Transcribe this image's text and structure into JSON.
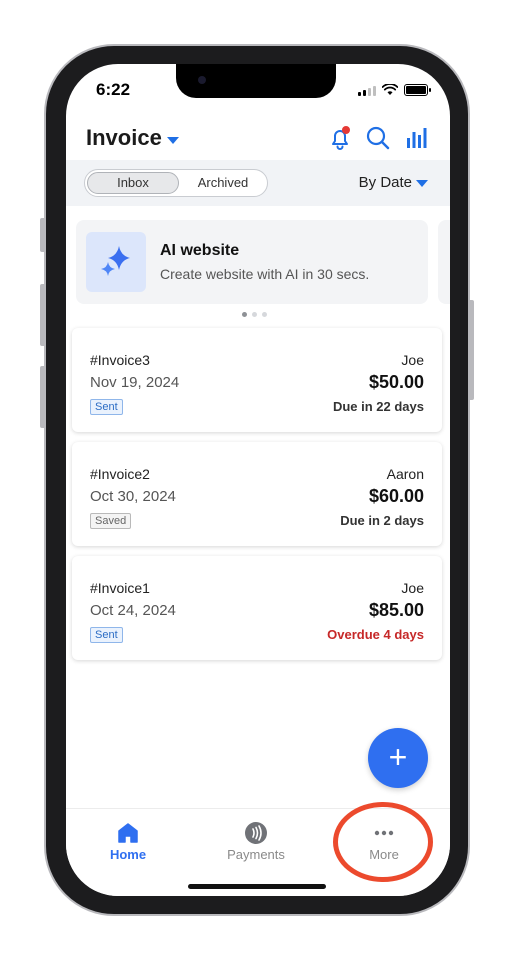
{
  "status_bar": {
    "time": "6:22"
  },
  "header": {
    "title": "Invoice"
  },
  "filter": {
    "tabs": [
      "Inbox",
      "Archived"
    ],
    "active_tab": "Inbox",
    "sort_label": "By Date"
  },
  "promo": {
    "title": "AI website",
    "subtitle": "Create website with AI in 30 secs.",
    "page_count": 3,
    "active_page": 1
  },
  "invoices": [
    {
      "number": "#Invoice3",
      "date": "Nov 19, 2024",
      "status": "Sent",
      "client": "Joe",
      "amount": "$50.00",
      "due": "Due in 22 days",
      "overdue": false
    },
    {
      "number": "#Invoice2",
      "date": "Oct 30, 2024",
      "status": "Saved",
      "client": "Aaron",
      "amount": "$60.00",
      "due": "Due in 2 days",
      "overdue": false
    },
    {
      "number": "#Invoice1",
      "date": "Oct 24, 2024",
      "status": "Sent",
      "client": "Joe",
      "amount": "$85.00",
      "due": "Overdue 4 days",
      "overdue": true
    }
  ],
  "bottom_nav": {
    "items": [
      {
        "label": "Home",
        "icon": "home-icon",
        "active": true
      },
      {
        "label": "Payments",
        "icon": "payments-icon",
        "active": false
      },
      {
        "label": "More",
        "icon": "more-icon",
        "active": false
      }
    ]
  },
  "colors": {
    "accent": "#2f6ff0",
    "overdue": "#c62828",
    "annotation": "#ec4a2d",
    "notification_dot": "#e53935"
  }
}
